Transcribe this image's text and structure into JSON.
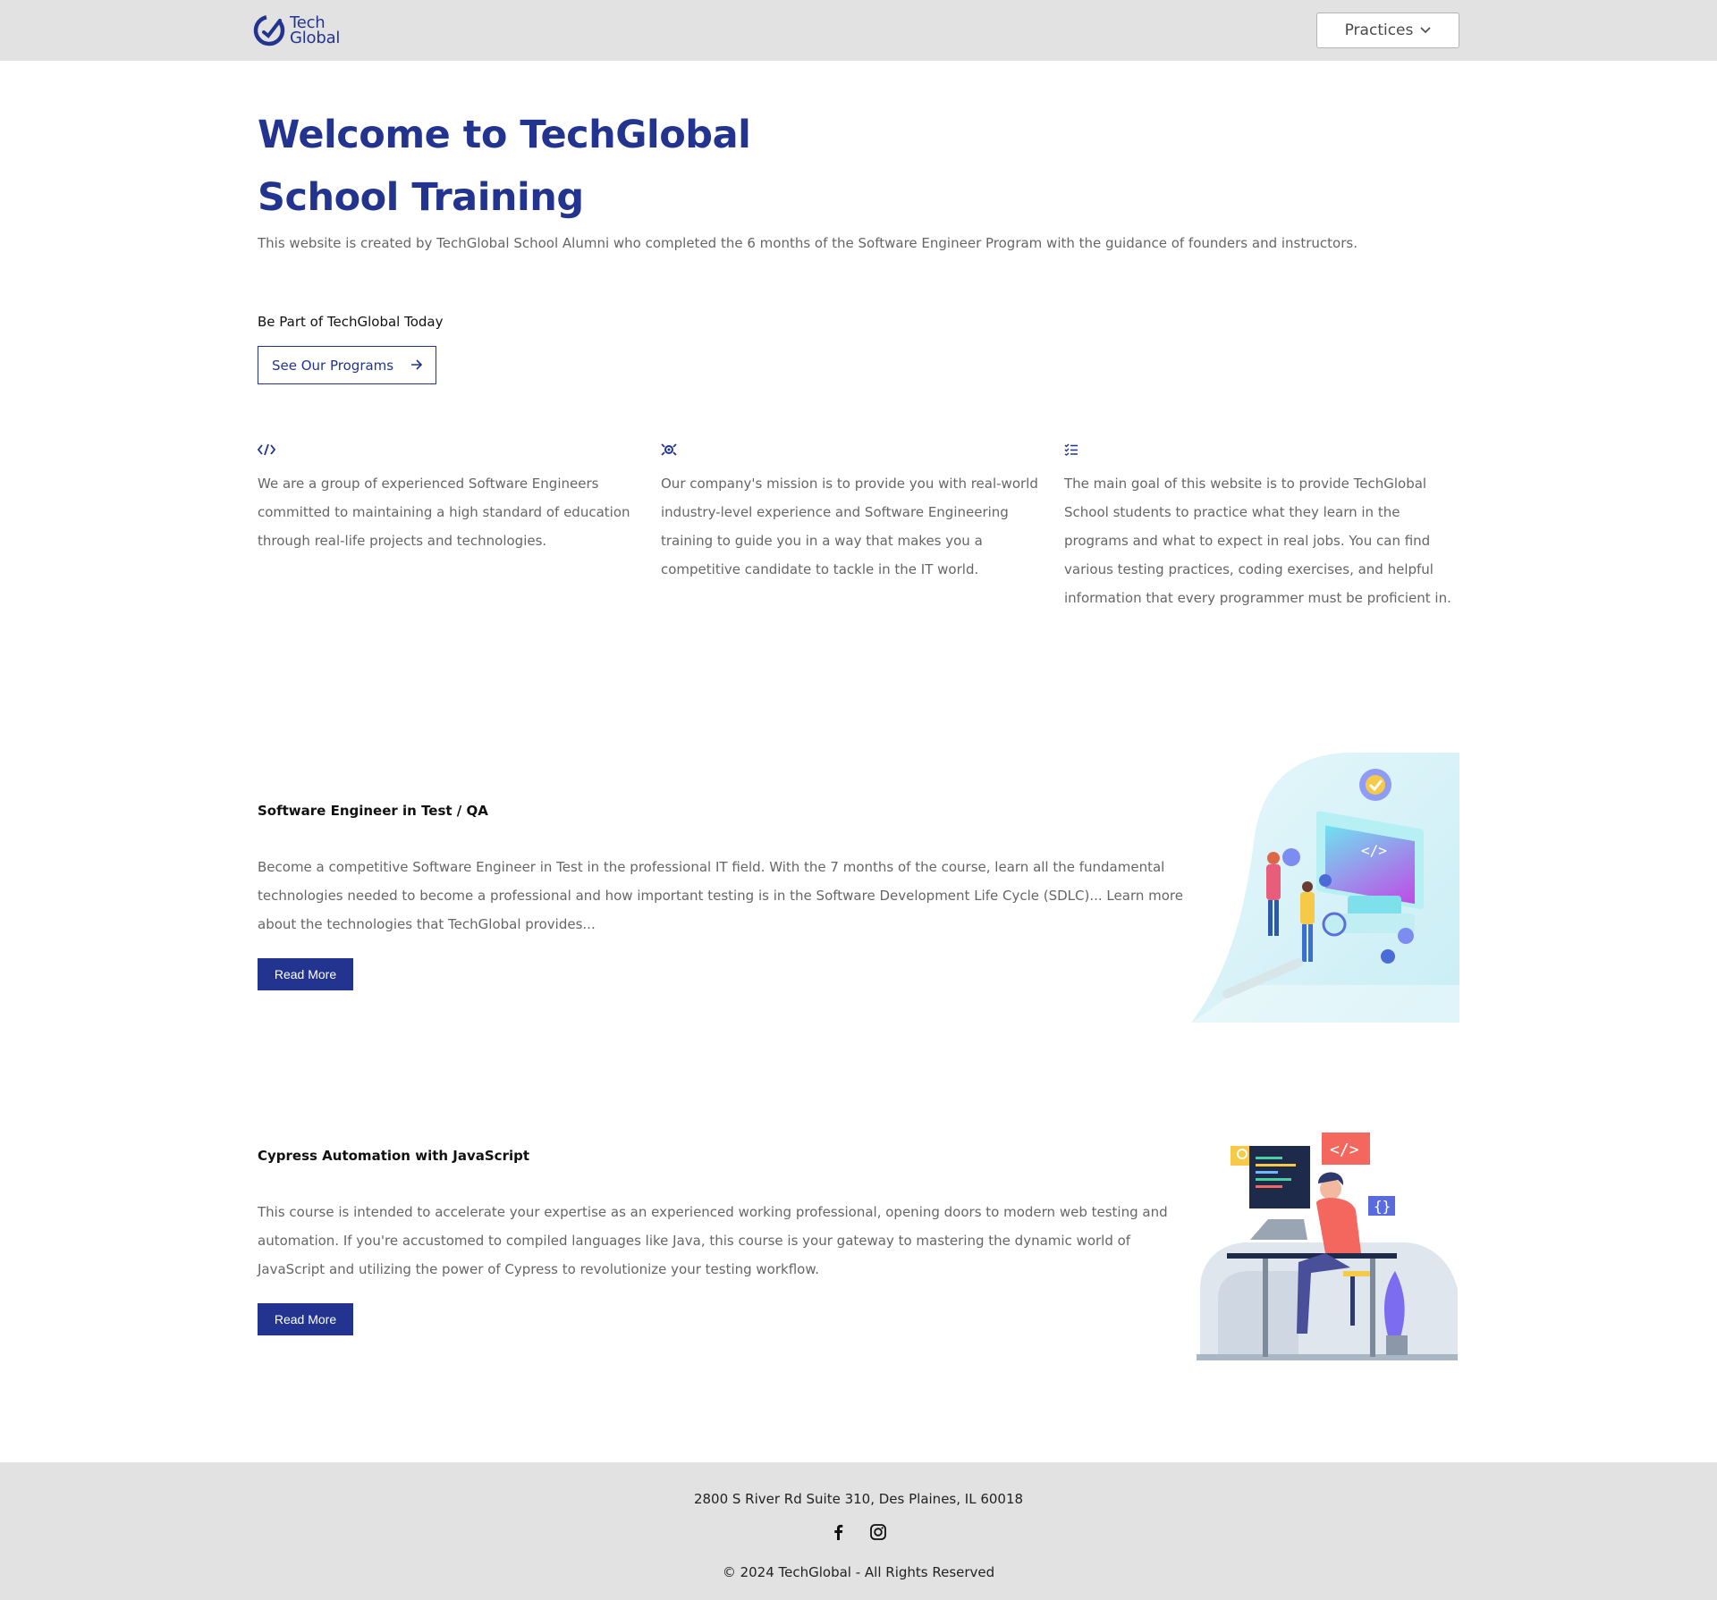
{
  "header": {
    "logo_line1": "Tech",
    "logo_line2": "Global",
    "practices_label": "Practices",
    "brand_color": "#22348f"
  },
  "hero": {
    "title": "Welcome to TechGlobal School Training",
    "subtitle": "This website is created by TechGlobal School Alumni who completed the 6 months of the Software Engineer Program with the guidance of founders and instructors."
  },
  "cta": {
    "heading": "Be Part of TechGlobal Today",
    "button_label": "See Our Programs"
  },
  "features": [
    {
      "icon": "code-icon",
      "text": "We are a group of experienced Software Engineers committed to maintaining a high standard of education through real-life projects and technologies."
    },
    {
      "icon": "target-icon",
      "text": "Our company's mission is to provide you with real-world industry-level experience and Software Engineering training to guide you in a way that makes you a competitive candidate to tackle in the IT world."
    },
    {
      "icon": "checklist-icon",
      "text": "The main goal of this website is to provide TechGlobal School students to practice what they learn in the programs and what to expect in real jobs. You can find various testing practices, coding exercises, and helpful information that every programmer must be proficient in."
    }
  ],
  "courses": [
    {
      "title": "Software Engineer in Test / QA",
      "description": "Become a competitive Software Engineer in Test in the professional IT field. With the 7 months of the course, learn all the fundamental technologies needed to become a professional and how important testing is in the Software Development Life Cycle (SDLC)... Learn more about the technologies that TechGlobal provides...",
      "button_label": "Read More"
    },
    {
      "title": "Cypress Automation with JavaScript",
      "description": "This course is intended to accelerate your expertise as an experienced working professional, opening doors to modern web testing and automation. If you're accustomed to compiled languages like Java, this course is your gateway to mastering the dynamic world of JavaScript and utilizing the power of Cypress to revolutionize your testing workflow.",
      "button_label": "Read More"
    }
  ],
  "footer": {
    "address": "2800 S River Rd Suite 310, Des Plaines, IL 60018",
    "copyright": "© 2024 TechGlobal - All Rights Reserved",
    "socials": [
      "facebook-icon",
      "instagram-icon"
    ]
  }
}
